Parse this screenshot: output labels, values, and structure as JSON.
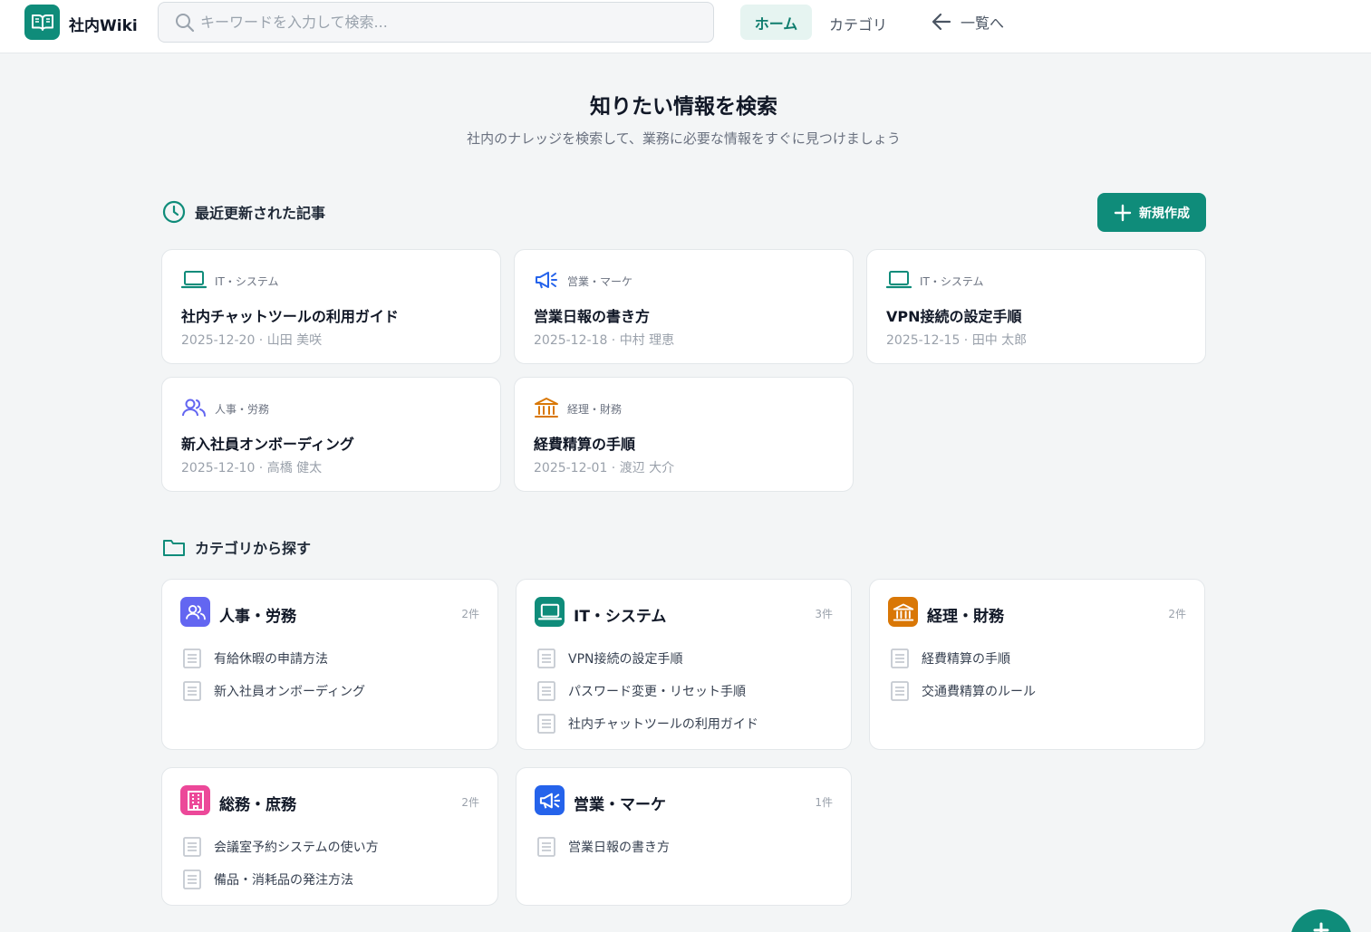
{
  "header": {
    "brand": "社内Wiki",
    "search_placeholder": "キーワードを入力して検索...",
    "nav_home": "ホーム",
    "nav_category": "カテゴリ",
    "nav_back": "一覧へ"
  },
  "hero": {
    "title": "知りたい情報を検索",
    "subtitle": "社内のナレッジを検索して、業務に必要な情報をすぐに見つけましょう"
  },
  "recent": {
    "heading": "最近更新された記事",
    "new_button": "新規作成",
    "articles": [
      {
        "category": "IT・システム",
        "icon": "laptop-icon",
        "title": "社内チャットツールの利用ガイド",
        "meta": "2025-12-20 · 山田 美咲"
      },
      {
        "category": "営業・マーケ",
        "icon": "megaphone-icon",
        "title": "営業日報の書き方",
        "meta": "2025-12-18 · 中村 理恵"
      },
      {
        "category": "IT・システム",
        "icon": "laptop-icon",
        "title": "VPN接続の設定手順",
        "meta": "2025-12-15 · 田中 太郎"
      },
      {
        "category": "人事・労務",
        "icon": "users-icon",
        "title": "新入社員オンボーディング",
        "meta": "2025-12-10 · 高橋 健太"
      },
      {
        "category": "経理・財務",
        "icon": "bank-icon",
        "title": "経費精算の手順",
        "meta": "2025-12-01 · 渡辺 大介"
      }
    ]
  },
  "categories": {
    "heading": "カテゴリから探す",
    "items": [
      {
        "name": "人事・労務",
        "count": "2件",
        "icon": "users-icon",
        "color": "#6366f1",
        "articles": [
          "有給休暇の申請方法",
          "新入社員オンボーディング"
        ]
      },
      {
        "name": "IT・システム",
        "count": "3件",
        "icon": "laptop-icon",
        "color": "#0f8c7a",
        "articles": [
          "VPN接続の設定手順",
          "パスワード変更・リセット手順",
          "社内チャットツールの利用ガイド"
        ]
      },
      {
        "name": "経理・財務",
        "count": "2件",
        "icon": "bank-icon",
        "color": "#d97706",
        "articles": [
          "経費精算の手順",
          "交通費精算のルール"
        ]
      },
      {
        "name": "総務・庶務",
        "count": "2件",
        "icon": "building-icon",
        "color": "#ec4899",
        "articles": [
          "会議室予約システムの使い方",
          "備品・消耗品の発注方法"
        ]
      },
      {
        "name": "営業・マーケ",
        "count": "1件",
        "icon": "megaphone-icon",
        "color": "#2563eb",
        "articles": [
          "営業日報の書き方"
        ]
      }
    ]
  },
  "colors": {
    "accent": "#0f8c7a",
    "accent_light": "#e6f4f1",
    "background": "#f3f5f6"
  }
}
